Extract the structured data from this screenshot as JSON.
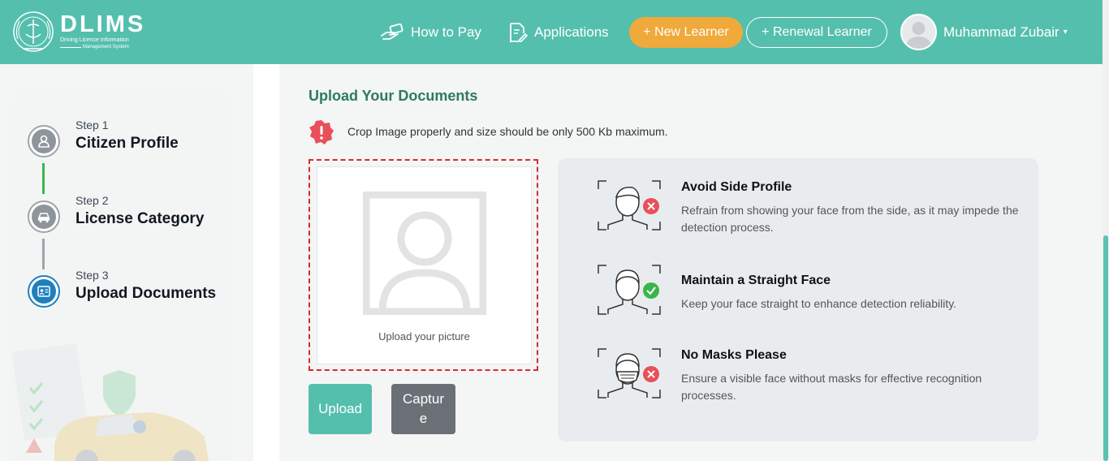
{
  "header": {
    "logo_title": "DLIMS",
    "logo_subtitle_1": "Driving Licence Information",
    "logo_subtitle_2": "Management System",
    "nav": {
      "how_to_pay": "How to Pay",
      "applications": "Applications",
      "new_learner": "+ New Learner",
      "renewal_learner": "+ Renewal Learner"
    },
    "user_name": "Muhammad Zubair"
  },
  "steps": [
    {
      "label": "Step 1",
      "title": "Citizen Profile"
    },
    {
      "label": "Step 2",
      "title": "License Category"
    },
    {
      "label": "Step 3",
      "title": "Upload Documents"
    }
  ],
  "upload": {
    "title": "Upload Your Documents",
    "warning": "Crop Image properly and size should be only 500 Kb maximum.",
    "placeholder_label": "Upload your picture",
    "upload_button": "Upload",
    "capture_button": "Capture"
  },
  "tips": [
    {
      "title": "Avoid Side Profile",
      "desc": "Refrain from showing your face from the side, as it may impede the detection process.",
      "status": "bad"
    },
    {
      "title": "Maintain a Straight Face",
      "desc": "Keep your face straight to enhance detection reliability.",
      "status": "good"
    },
    {
      "title": "No Masks Please",
      "desc": "Ensure a visible face without masks for effective recognition processes.",
      "status": "bad"
    }
  ],
  "colors": {
    "header": "#55bfae",
    "accent_orange": "#f0a93b",
    "title_green": "#2c7a62",
    "active_step": "#1f7fbe",
    "error_red": "#e8505b",
    "success_green": "#3bb54a"
  }
}
